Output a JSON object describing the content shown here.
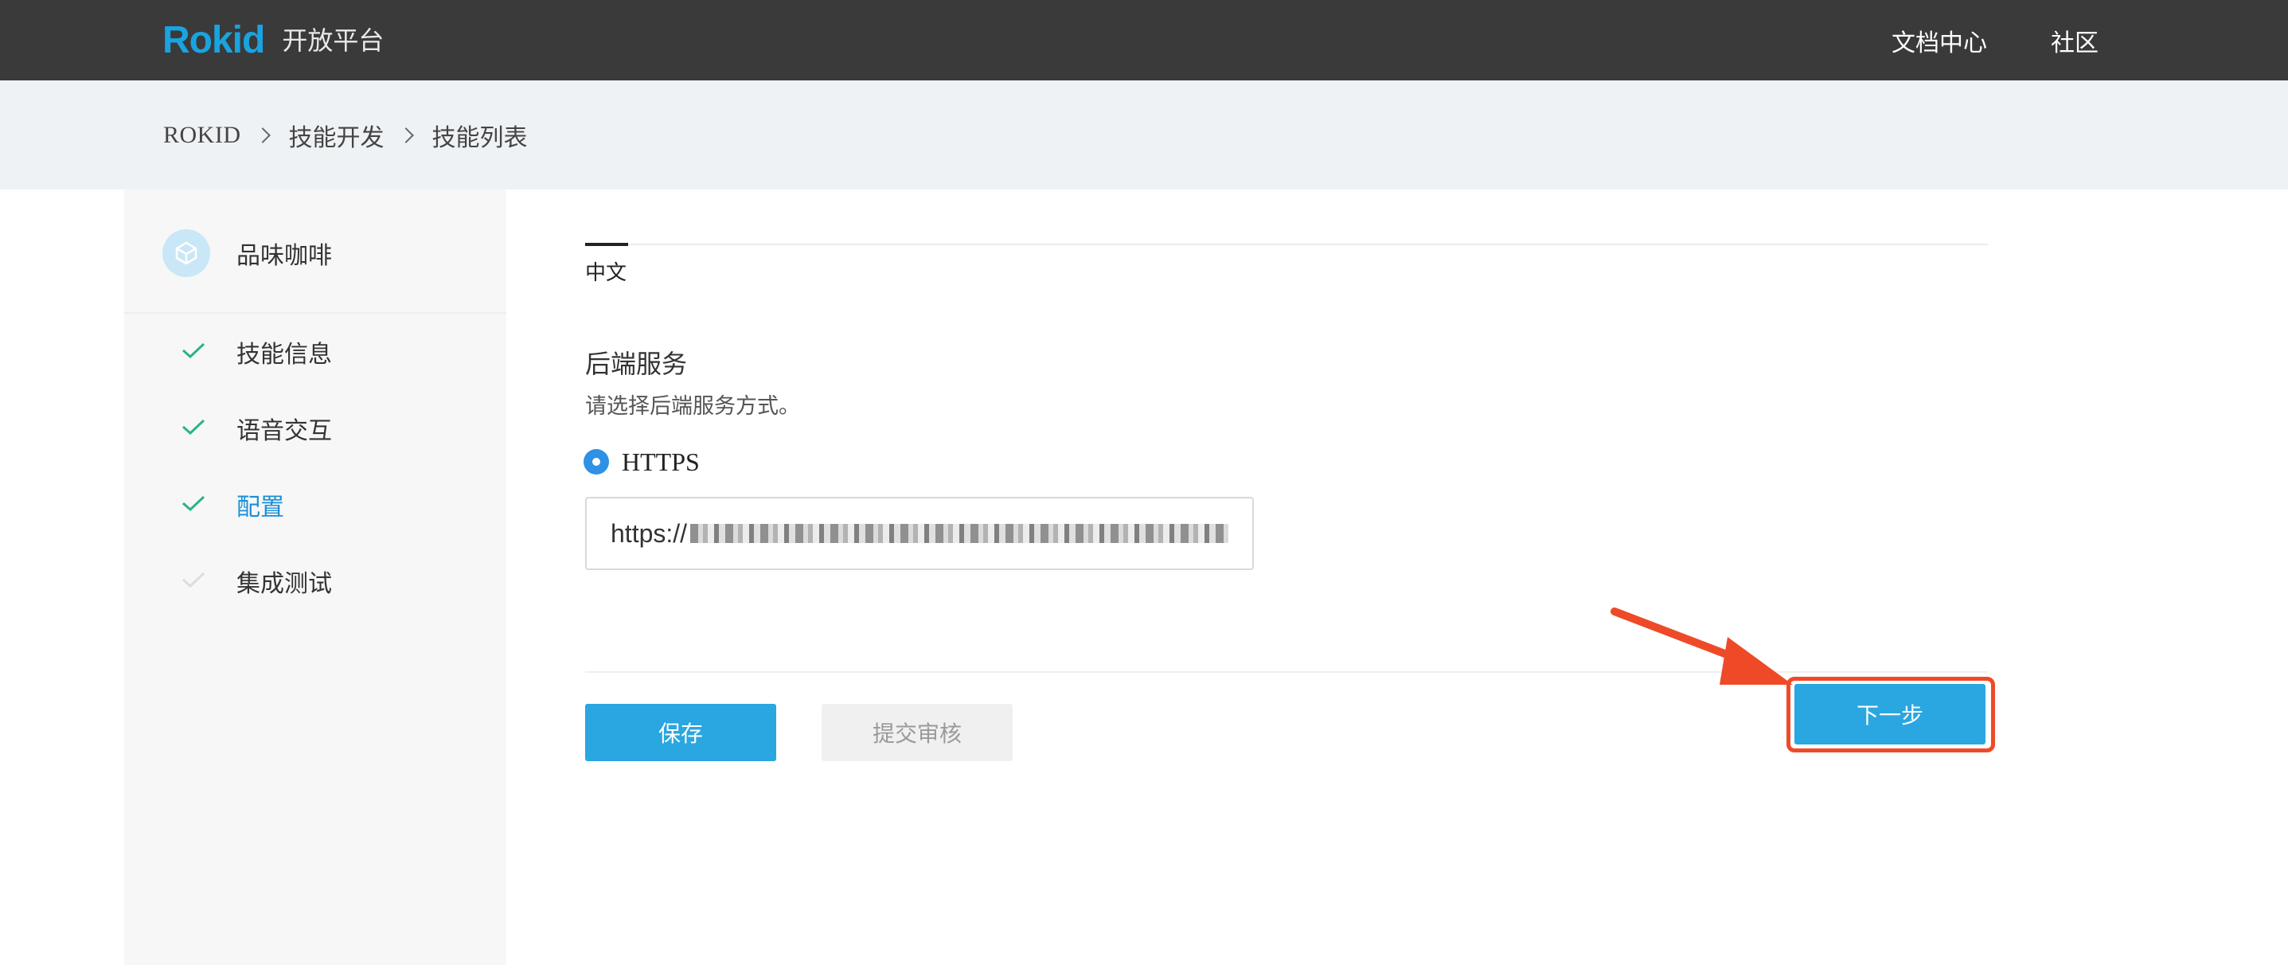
{
  "header": {
    "logo": "Rokid",
    "platform": "开放平台",
    "nav": {
      "docs": "文档中心",
      "community": "社区"
    }
  },
  "breadcrumb": {
    "items": [
      "ROKID",
      "技能开发",
      "技能列表"
    ]
  },
  "sidebar": {
    "app_name": "品味咖啡",
    "steps": [
      {
        "label": "技能信息",
        "status": "done"
      },
      {
        "label": "语音交互",
        "status": "done"
      },
      {
        "label": "配置",
        "status": "active"
      },
      {
        "label": "集成测试",
        "status": "pending"
      }
    ]
  },
  "main": {
    "tabs": [
      {
        "label": "中文",
        "selected": true
      }
    ],
    "section": {
      "title": "后端服务",
      "description": "请选择后端服务方式。"
    },
    "service_option": {
      "label": "HTTPS",
      "selected": true
    },
    "url_field": {
      "value_prefix": "https://"
    }
  },
  "actions": {
    "save": "保存",
    "submit_review": "提交审核",
    "next": "下一步"
  },
  "colors": {
    "accent": "#2aa6e0",
    "check": "#2bb38a",
    "annotation": "#ee4a28"
  }
}
